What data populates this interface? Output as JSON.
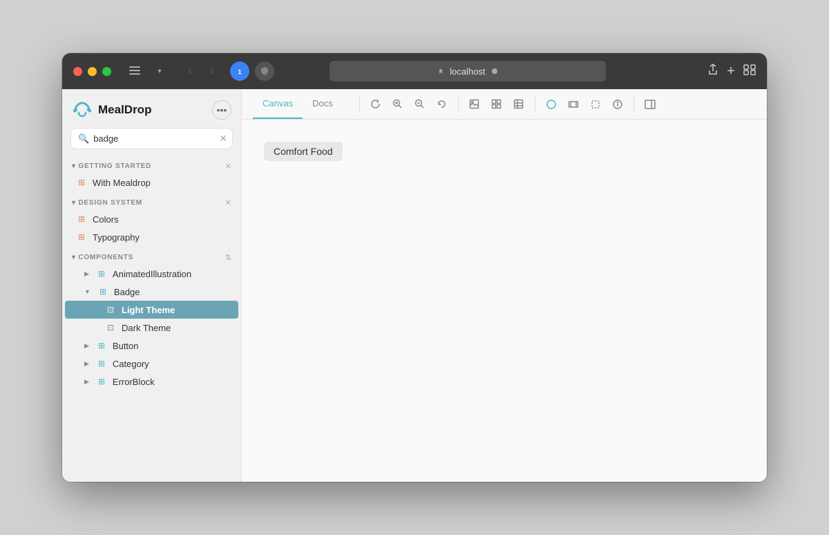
{
  "window": {
    "title": "localhost"
  },
  "titlebar": {
    "url": "localhost",
    "reload_label": "↺",
    "back_label": "‹",
    "forward_label": "›"
  },
  "sidebar": {
    "logo_text": "MealDrop",
    "search_placeholder": "badge",
    "search_value": "badge",
    "sections": [
      {
        "id": "getting-started",
        "label": "GETTING STARTED",
        "items": [
          {
            "id": "with-mealdrop",
            "label": "With Mealdrop",
            "indent": 0,
            "icon": "page"
          }
        ]
      },
      {
        "id": "design-system",
        "label": "DESIGN SYSTEM",
        "items": [
          {
            "id": "colors",
            "label": "Colors",
            "indent": 0,
            "icon": "page"
          },
          {
            "id": "typography",
            "label": "Typography",
            "indent": 0,
            "icon": "page"
          }
        ]
      },
      {
        "id": "components",
        "label": "COMPONENTS",
        "items": [
          {
            "id": "animated-illustration",
            "label": "AnimatedIllustration",
            "indent": 0,
            "icon": "grid",
            "hasChevron": true
          },
          {
            "id": "badge",
            "label": "Badge",
            "indent": 0,
            "icon": "grid",
            "hasChevron": true,
            "expanded": true
          },
          {
            "id": "light-theme",
            "label": "Light Theme",
            "indent": 2,
            "icon": "component",
            "active": true
          },
          {
            "id": "dark-theme",
            "label": "Dark Theme",
            "indent": 2,
            "icon": "component"
          },
          {
            "id": "button",
            "label": "Button",
            "indent": 0,
            "icon": "grid",
            "hasChevron": true
          },
          {
            "id": "category",
            "label": "Category",
            "indent": 0,
            "icon": "grid",
            "hasChevron": true
          },
          {
            "id": "errorblock",
            "label": "ErrorBlock",
            "indent": 0,
            "icon": "grid",
            "hasChevron": true
          }
        ]
      }
    ]
  },
  "toolbar": {
    "tabs": [
      {
        "id": "canvas",
        "label": "Canvas",
        "active": true
      },
      {
        "id": "docs",
        "label": "Docs",
        "active": false
      }
    ],
    "buttons": [
      {
        "id": "refresh",
        "icon": "↺",
        "label": "refresh"
      },
      {
        "id": "zoom-in",
        "icon": "⊕",
        "label": "zoom-in"
      },
      {
        "id": "zoom-out",
        "icon": "⊖",
        "label": "zoom-out"
      },
      {
        "id": "reset",
        "icon": "⟲",
        "label": "reset"
      },
      {
        "id": "image",
        "icon": "▣",
        "label": "image"
      },
      {
        "id": "grid",
        "icon": "⊞",
        "label": "grid"
      },
      {
        "id": "table",
        "icon": "▦",
        "label": "table"
      },
      {
        "id": "circle-tool",
        "icon": "○",
        "label": "circle",
        "active": true
      },
      {
        "id": "resize",
        "icon": "⊟",
        "label": "resize"
      },
      {
        "id": "frame",
        "icon": "⬚",
        "label": "frame"
      },
      {
        "id": "info",
        "icon": "ⓘ",
        "label": "info"
      },
      {
        "id": "panel",
        "icon": "▭",
        "label": "panel"
      }
    ]
  },
  "canvas": {
    "badge_text": "Comfort Food"
  }
}
